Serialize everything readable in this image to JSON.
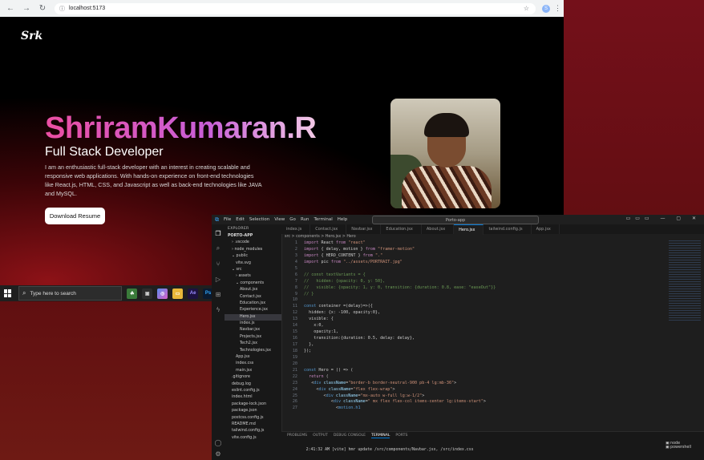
{
  "browser": {
    "url": "localhost:5173",
    "profile_initial": "S"
  },
  "site": {
    "logo": "Srk",
    "name": "ShriramKumaran.R",
    "role": "Full Stack Developer",
    "description": "I am an enthusiastic full-stack developer with an interest in creating scalable and responsive web applications. With hands-on experience on front-end technologies like React.js, HTML, CSS, and Javascript as well as back-end technologies like JAVA and MySQL.",
    "button": "Download Resume"
  },
  "taskbar": {
    "search_placeholder": "Type here to search",
    "icons": [
      "Ae",
      "Ps"
    ]
  },
  "vscode": {
    "menu": [
      "File",
      "Edit",
      "Selection",
      "View",
      "Go",
      "Run",
      "Terminal",
      "Help"
    ],
    "search": "Porto-app",
    "explorer_title": "EXPLORER",
    "tree": [
      {
        "label": "PORTO-APP",
        "indent": 0
      },
      {
        "label": "› .vscode",
        "indent": 1
      },
      {
        "label": "› node_modules",
        "indent": 1
      },
      {
        "label": "⌄ public",
        "indent": 1
      },
      {
        "label": "vite.svg",
        "indent": 2
      },
      {
        "label": "⌄ src",
        "indent": 1
      },
      {
        "label": "› assets",
        "indent": 2
      },
      {
        "label": "⌄ components",
        "indent": 2
      },
      {
        "label": "About.jsx",
        "indent": 3
      },
      {
        "label": "Contact.jsx",
        "indent": 3
      },
      {
        "label": "Education.jsx",
        "indent": 3
      },
      {
        "label": "Experience.jsx",
        "indent": 3
      },
      {
        "label": "Hero.jsx",
        "indent": 3,
        "selected": true
      },
      {
        "label": "index.js",
        "indent": 3
      },
      {
        "label": "Navbar.jsx",
        "indent": 3
      },
      {
        "label": "Projects.jsx",
        "indent": 3
      },
      {
        "label": "Tech2.jsx",
        "indent": 3
      },
      {
        "label": "Technologies.jsx",
        "indent": 3
      },
      {
        "label": "App.jsx",
        "indent": 2
      },
      {
        "label": "index.css",
        "indent": 2
      },
      {
        "label": "main.jsx",
        "indent": 2
      },
      {
        "label": ".gitignore",
        "indent": 1
      },
      {
        "label": "debug.log",
        "indent": 1
      },
      {
        "label": "eslint.config.js",
        "indent": 1
      },
      {
        "label": "index.html",
        "indent": 1
      },
      {
        "label": "package-lock.json",
        "indent": 1
      },
      {
        "label": "package.json",
        "indent": 1
      },
      {
        "label": "postcss.config.js",
        "indent": 1
      },
      {
        "label": "README.md",
        "indent": 1
      },
      {
        "label": "tailwind.config.js",
        "indent": 1
      },
      {
        "label": "vite.config.js",
        "indent": 1
      }
    ],
    "tabs": [
      "index.js",
      "Contact.jsx",
      "Navbar.jsx",
      "Education.jsx",
      "About.jsx",
      "Hero.jsx",
      "tailwind.config.js",
      "App.jsx"
    ],
    "active_tab": "Hero.jsx",
    "breadcrumb": "src > components > Hero.jsx > Hero",
    "code_lines": [
      "import React from \"react\"",
      "import { delay, motion } from \"framer-motion\"",
      "import { HERO_CONTENT } from \".\"",
      "import pic from \"../assets/PORTRAIT.jpg\"",
      "",
      "// const textVariants = {",
      "//   hidden: {opacity: 0, y: 50},",
      "//   visible: {opacity: 1, y: 0, transition: {duration: 0.8, ease: \"easeOut\"}}",
      "// }",
      "",
      "const container =(delay)=>({",
      "  hidden: {x: -100, opacity:0},",
      "  visible: {",
      "    x:0,",
      "    opacity:1,",
      "    transition:{duration: 0.5, delay: delay},",
      "  },",
      "});",
      "",
      "",
      "const Hero = () => (",
      "  return (",
      "   <div className=\"border-b border-neutral-900 pb-4 lg:mb-36\">",
      "     <div className=\"flex flex-wrap\">",
      "        <div className=\"mx-auto w-full lg:w-1/2\">",
      "           <div className=\" mx flex flex-col items-center lg:items-start\">",
      "             <motion.h1"
    ],
    "panel_tabs": [
      "PROBLEMS",
      "OUTPUT",
      "DEBUG CONSOLE",
      "TERMINAL",
      "PORTS"
    ],
    "active_panel": "TERMINAL",
    "terminal_line": "2:41:32 AM [vite] hmr update /src/components/Navbar.jsx, /src/index.css",
    "terminal_sessions": [
      "node",
      "powershell"
    ]
  }
}
